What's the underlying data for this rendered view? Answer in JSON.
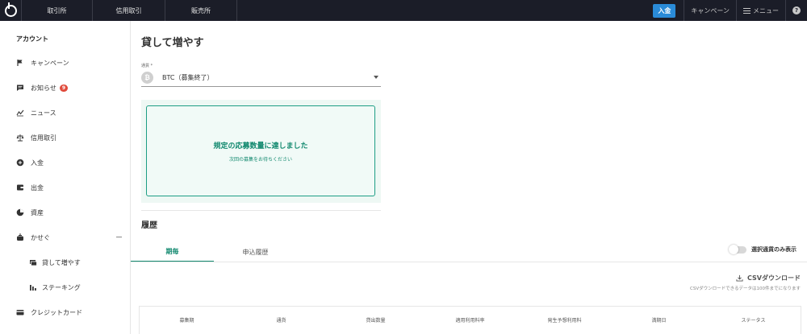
{
  "topbar": {
    "nav": [
      "取引所",
      "信用取引",
      "販売所"
    ],
    "deposit_label": "入金",
    "campaign_label": "キャンペーン",
    "menu_label": "メニュー",
    "help_label": "?"
  },
  "sidebar": {
    "title": "アカウント",
    "items": [
      {
        "label": "キャンペーン",
        "icon": "flag-icon"
      },
      {
        "label": "お知らせ",
        "icon": "message-icon",
        "badge": "9"
      },
      {
        "label": "ニュース",
        "icon": "news-chart-icon"
      },
      {
        "label": "信用取引",
        "icon": "scale-icon"
      },
      {
        "label": "入金",
        "icon": "plus-circle-icon"
      },
      {
        "label": "出金",
        "icon": "wallet-icon"
      },
      {
        "label": "資産",
        "icon": "pie-chart-icon"
      },
      {
        "label": "かせぐ",
        "icon": "piggy-bank-icon"
      },
      {
        "label": "貸して増やす",
        "icon": "lend-icon"
      },
      {
        "label": "ステーキング",
        "icon": "bar-chart-icon"
      },
      {
        "label": "クレジットカード",
        "icon": "credit-card-icon"
      }
    ]
  },
  "main": {
    "title": "貸して増やす",
    "currency_label": "通貨 *",
    "currency_icon_glyph": "₿",
    "currency_value": "BTC（募集終了）",
    "notice_title": "規定の応募数量に達しました",
    "notice_sub": "次回の募集をお待ちください",
    "history_title": "履歴",
    "tabs": [
      "期毎",
      "申込履歴"
    ],
    "toggle_label": "選択通貨のみ表示",
    "csv_label": "CSVダウンロード",
    "csv_note": "CSVダウンロードできるデータは100件までになります",
    "table_headers": [
      "募集期",
      "通貨",
      "貸出数量",
      "適用利用料率",
      "発生予想利用料",
      "満期日",
      "ステータス"
    ]
  },
  "colors": {
    "topbar": "#1b1d28",
    "accent_green": "#12896f",
    "deposit_blue": "#2a8bd8",
    "badge_red": "#e04b3c"
  }
}
